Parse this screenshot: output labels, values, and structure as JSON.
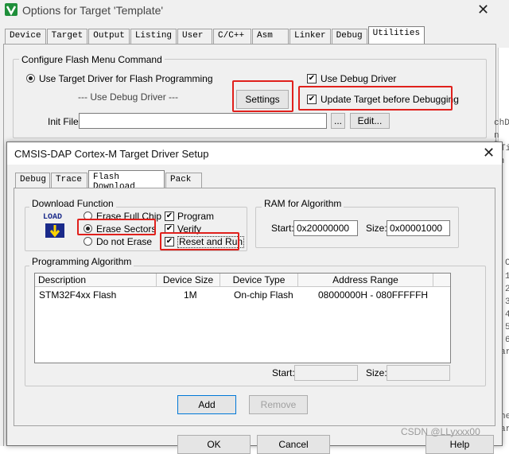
{
  "outer": {
    "title": "Options for Target 'Template'",
    "tabs": [
      "Device",
      "Target",
      "Output",
      "Listing",
      "User",
      "C/C++",
      "Asm",
      "Linker",
      "Debug",
      "Utilities"
    ],
    "group_title": "Configure Flash Menu Command",
    "use_target_driver": "Use Target Driver for Flash Programming",
    "use_debug_driver_center": "--- Use Debug Driver ---",
    "settings_button": "Settings",
    "use_debug_driver_cb": "Use Debug Driver",
    "update_target": "Update Target before Debugging",
    "init_file_label": "Init File:",
    "browse_button": "...",
    "edit_button": "Edit..."
  },
  "bg_code": [
    "chD",
    "n B",
    "Ti",
    "ch",
    "C",
    "1",
    "2",
    "3",
    "4",
    "5",
    "6",
    "ar",
    "he",
    "ar"
  ],
  "dialog": {
    "title": "CMSIS-DAP Cortex-M Target Driver Setup",
    "tabs": [
      "Debug",
      "Trace",
      "Flash Download",
      "Pack"
    ],
    "download_function": "Download Function",
    "load_icon_text": "LOAD",
    "erase_full_chip": "Erase Full Chip",
    "erase_sectors": "Erase Sectors",
    "do_not_erase": "Do not Erase",
    "program": "Program",
    "verify": "Verify",
    "reset_and_run": "Reset and Run",
    "ram_group": "RAM for Algorithm",
    "start_label": "Start:",
    "start_value": "0x20000000",
    "size_label": "Size:",
    "size_value": "0x00001000",
    "prog_algo": "Programming Algorithm",
    "columns": [
      "Description",
      "Device Size",
      "Device Type",
      "Address Range"
    ],
    "rows": [
      {
        "desc": "STM32F4xx Flash",
        "size": "1M",
        "type": "On-chip Flash",
        "range": "08000000H - 080FFFFFH"
      }
    ],
    "start2_label": "Start:",
    "size2_label": "Size:",
    "add_button": "Add",
    "remove_button": "Remove",
    "ok_button": "OK",
    "cancel_button": "Cancel",
    "help_button": "Help"
  },
  "watermark": "CSDN @LLyxxx00"
}
